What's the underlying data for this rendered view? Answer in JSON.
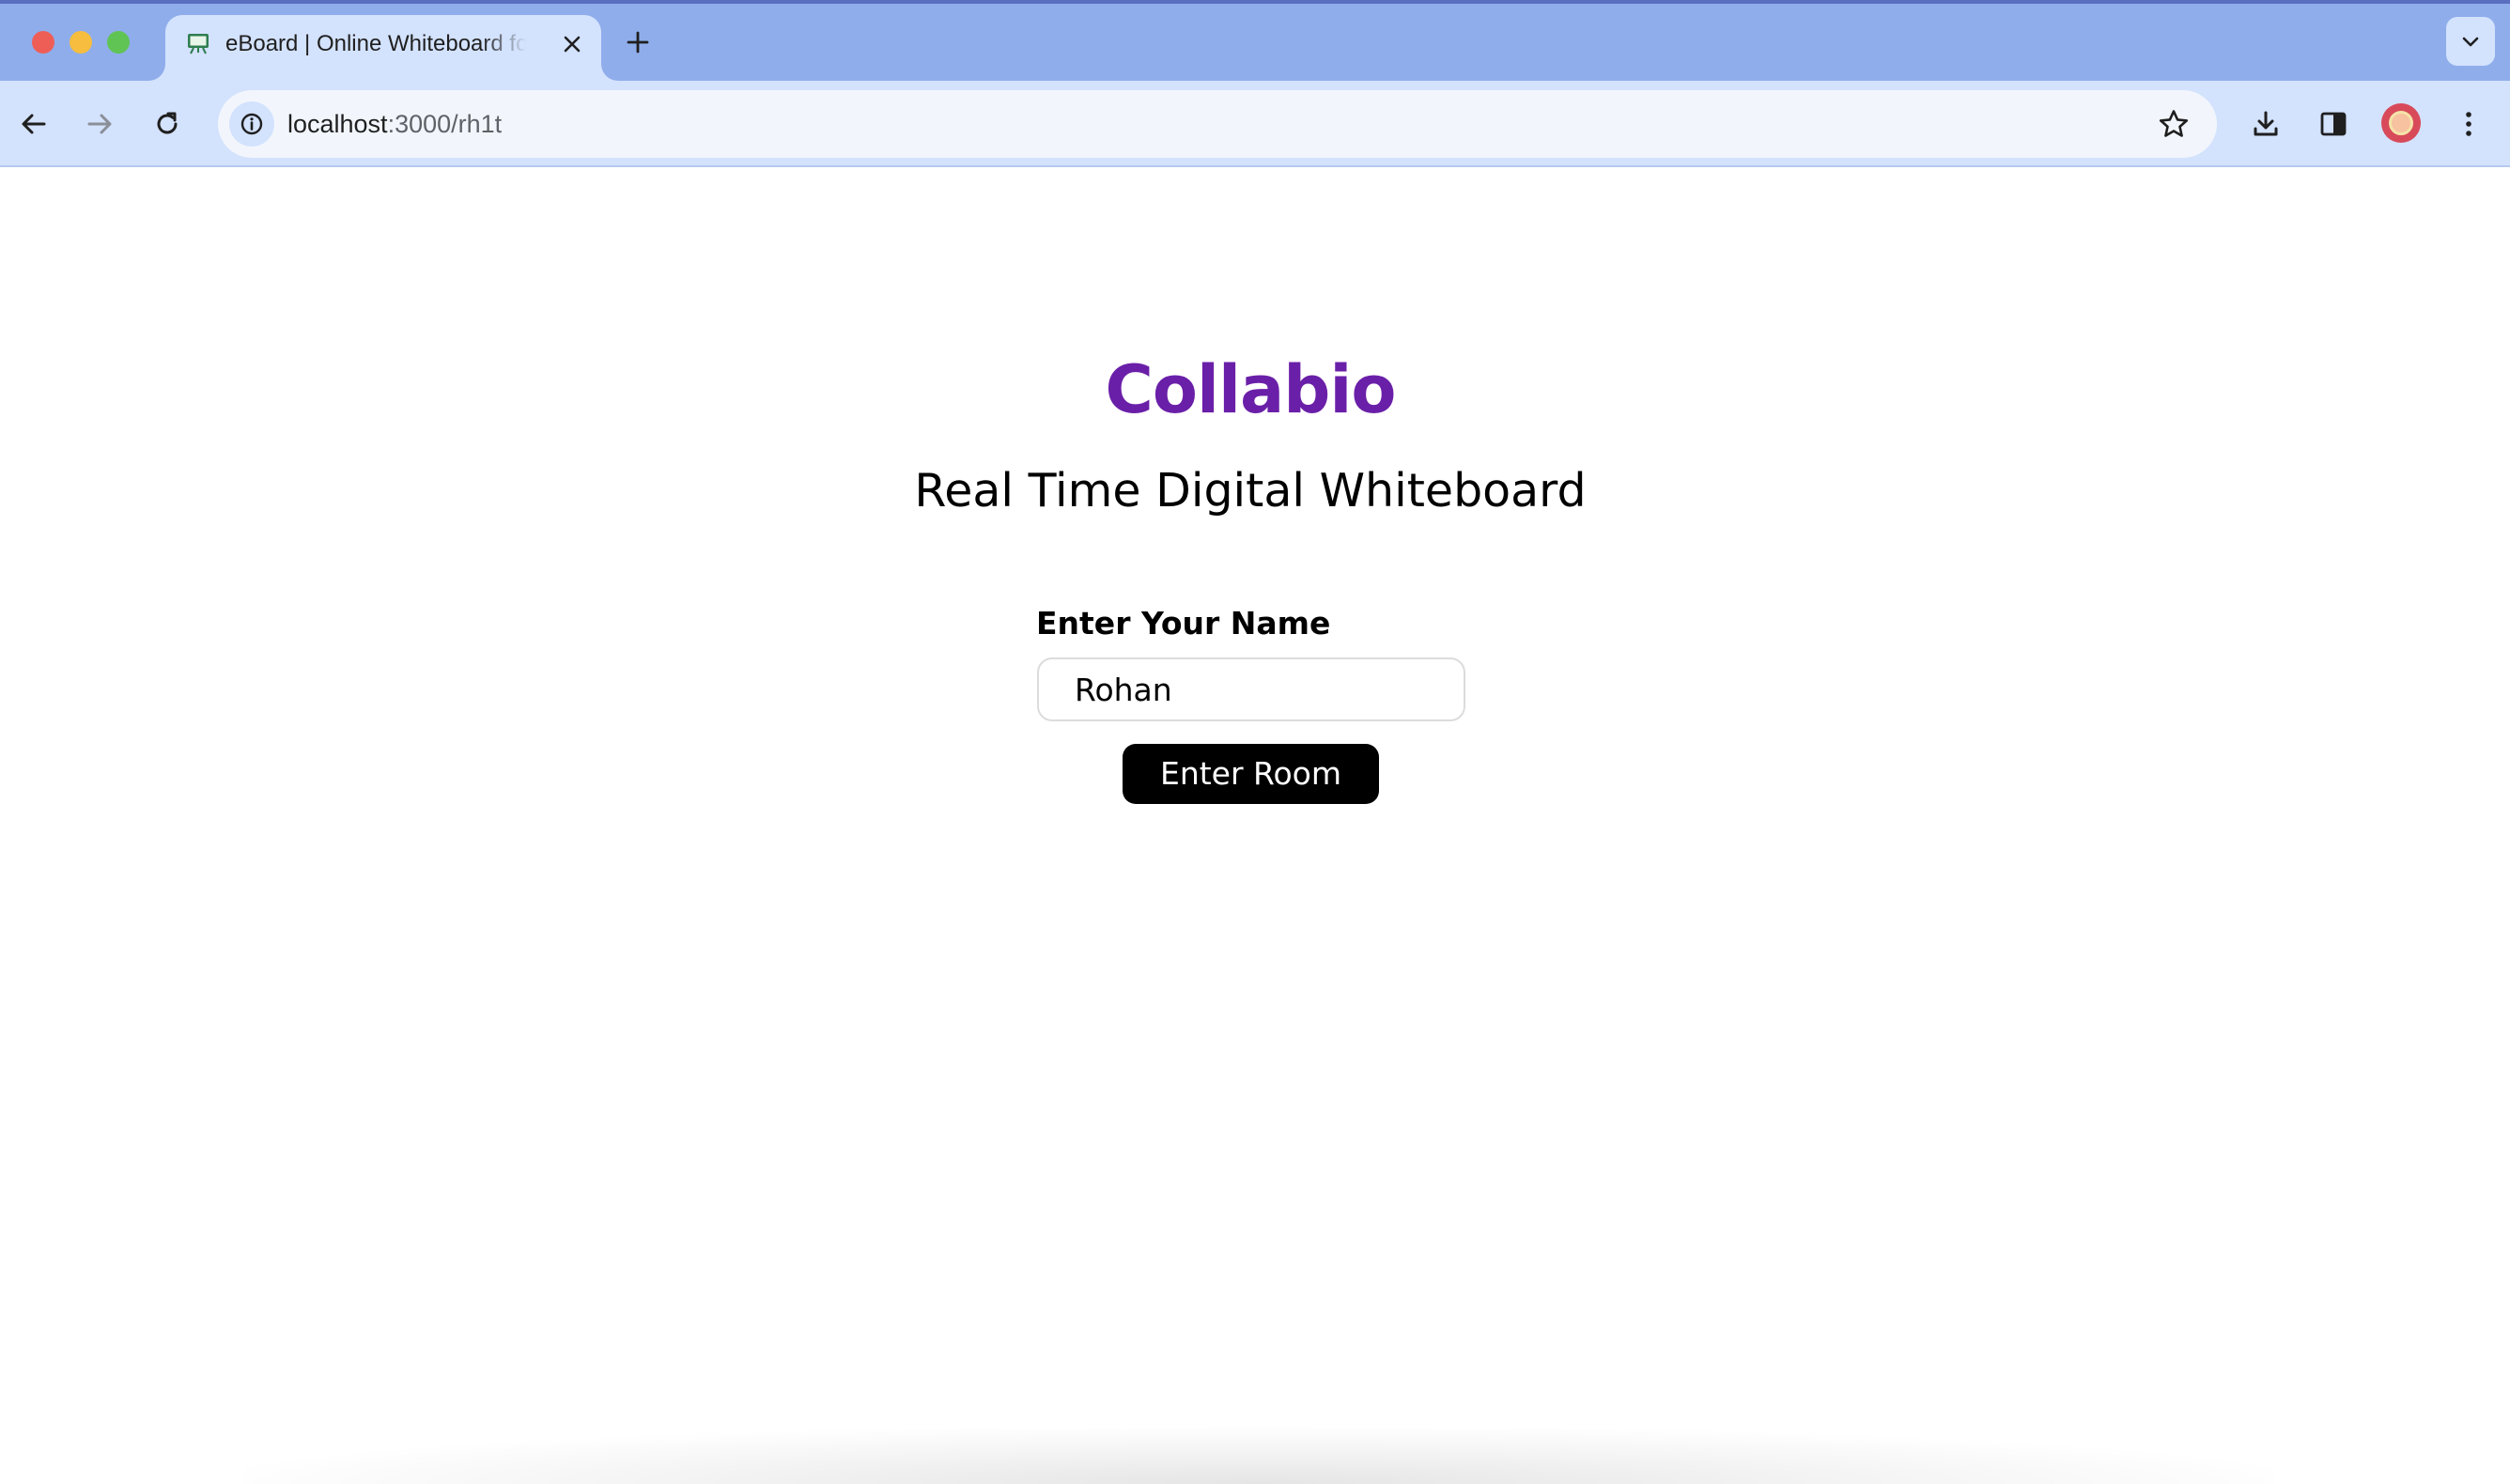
{
  "browser": {
    "tab": {
      "title": "eBoard | Online Whiteboard for Collaboration",
      "favicon": "whiteboard-icon"
    },
    "address_bar": {
      "host": "localhost",
      "path": ":3000/rh1t"
    },
    "icons": {
      "back": "back-arrow-icon",
      "forward": "forward-arrow-icon",
      "reload": "reload-icon",
      "site_info": "info-icon",
      "bookmark": "star-icon",
      "downloads": "download-icon",
      "side_panel": "side-panel-icon",
      "profile": "avatar",
      "menu": "kebab-menu-icon",
      "new_tab": "plus-icon",
      "tab_search": "chevron-down-icon",
      "close_tab": "close-icon"
    },
    "colors": {
      "tab_strip": "#8fadeb",
      "toolbar": "#d3e2fd"
    }
  },
  "page": {
    "brand": "Collabio",
    "subtitle": "Real Time Digital Whiteboard",
    "form": {
      "name_label": "Enter Your Name",
      "name_value": "Rohan",
      "submit_label": "Enter Room"
    },
    "colors": {
      "brand": "#6a1fa8",
      "button_bg": "#000000",
      "button_text": "#ffffff"
    }
  }
}
